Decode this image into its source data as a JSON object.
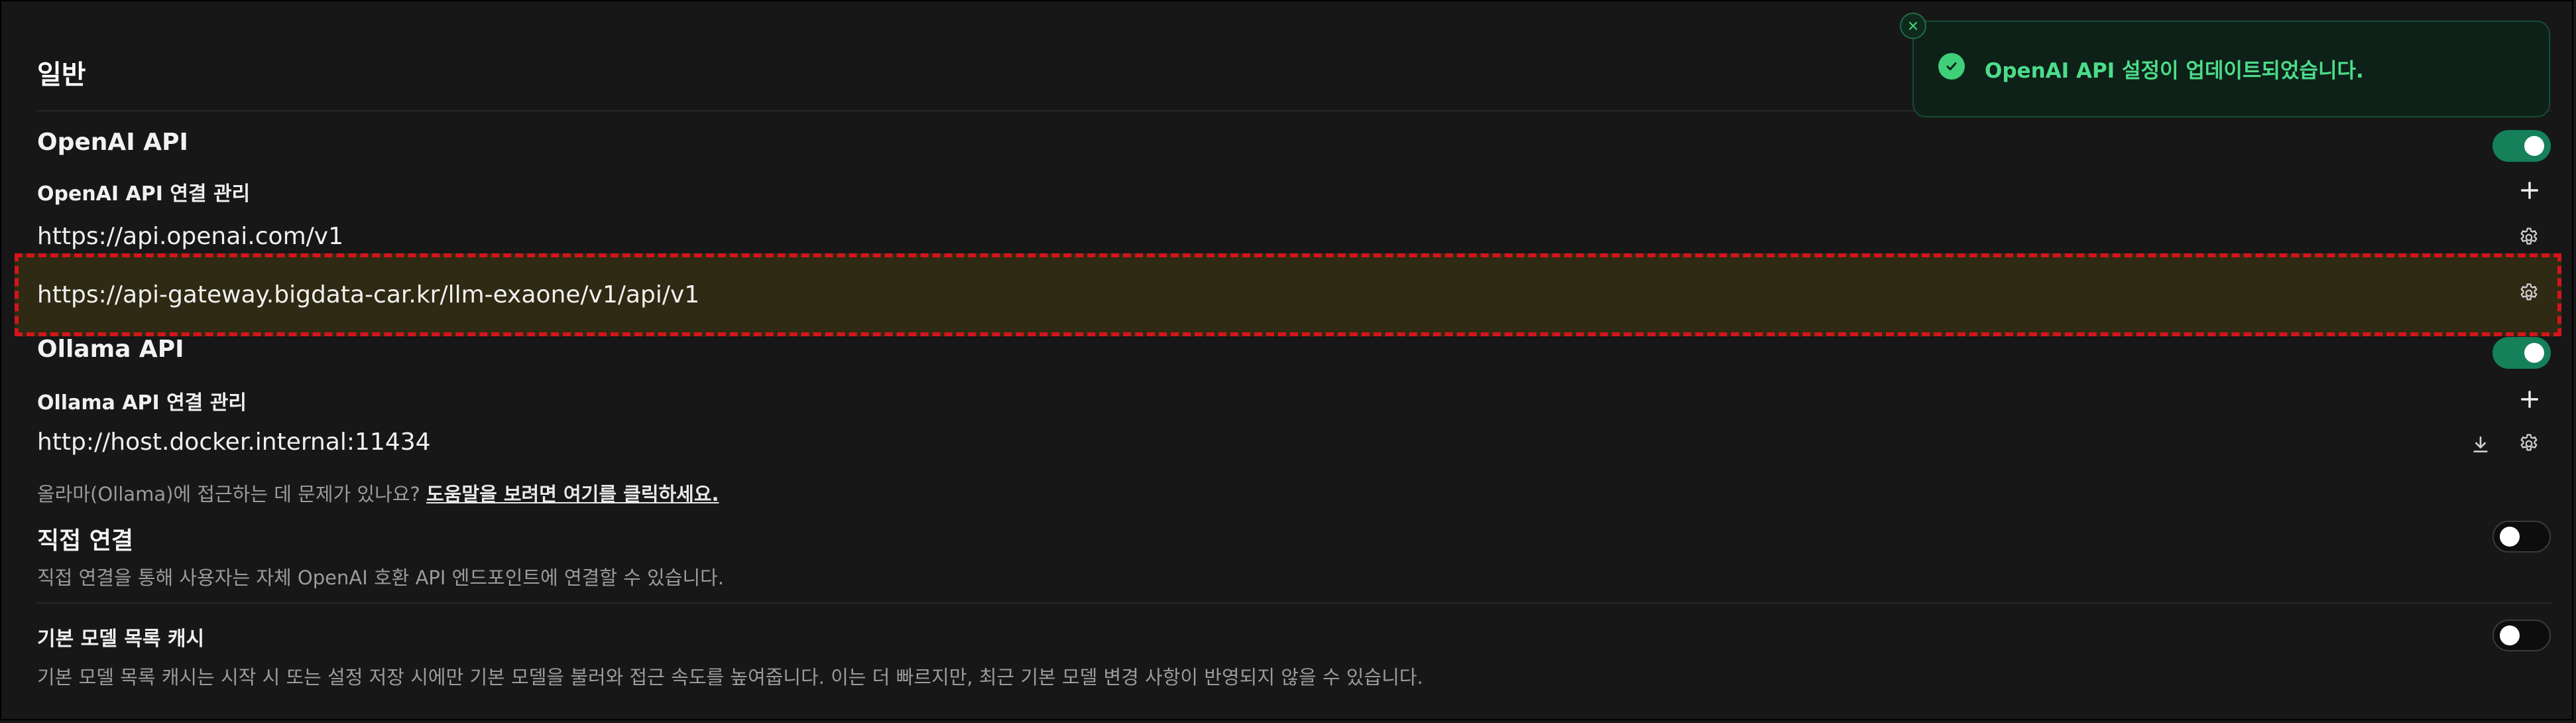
{
  "section_title": "일반",
  "openai": {
    "label": "OpenAI API",
    "enabled": true,
    "manage_label": "OpenAI API 연결 관리",
    "connections": [
      "https://api.openai.com/v1",
      "https://api-gateway.bigdata-car.kr/llm-exaone/v1/api/v1"
    ]
  },
  "ollama": {
    "label": "Ollama API",
    "enabled": true,
    "manage_label": "Ollama API 연결 관리",
    "connections": [
      "http://host.docker.internal:11434"
    ],
    "help_text": "올라마(Ollama)에 접근하는 데 문제가 있나요?",
    "help_link": "도움말을 보려면 여기를 클릭하세요."
  },
  "direct_connection": {
    "label": "직접 연결",
    "description": "직접 연결을 통해 사용자는 자체 OpenAI 호환 API 엔드포인트에 연결할 수 있습니다.",
    "enabled": false
  },
  "model_cache": {
    "label": "기본 모델 목록 캐시",
    "description": "기본 모델 목록 캐시는 시작 시 또는 설정 저장 시에만 기본 모델을 불러와 접근 속도를 높여줍니다. 이는 더 빠르지만, 최근 기본 모델 변경 사항이 반영되지 않을 수 있습니다.",
    "enabled": false
  },
  "toast": {
    "message": "OpenAI API 설정이 업데이트되었습니다."
  },
  "colors": {
    "accent": "#15805a",
    "toast_text": "#4ddc8a",
    "highlight_border": "#d4151b",
    "highlight_fill": "#2e2a13"
  },
  "icons": {
    "add": "plus-icon",
    "settings": "gear-icon",
    "download": "download-icon",
    "success": "check-circle-icon",
    "close": "close-icon"
  }
}
